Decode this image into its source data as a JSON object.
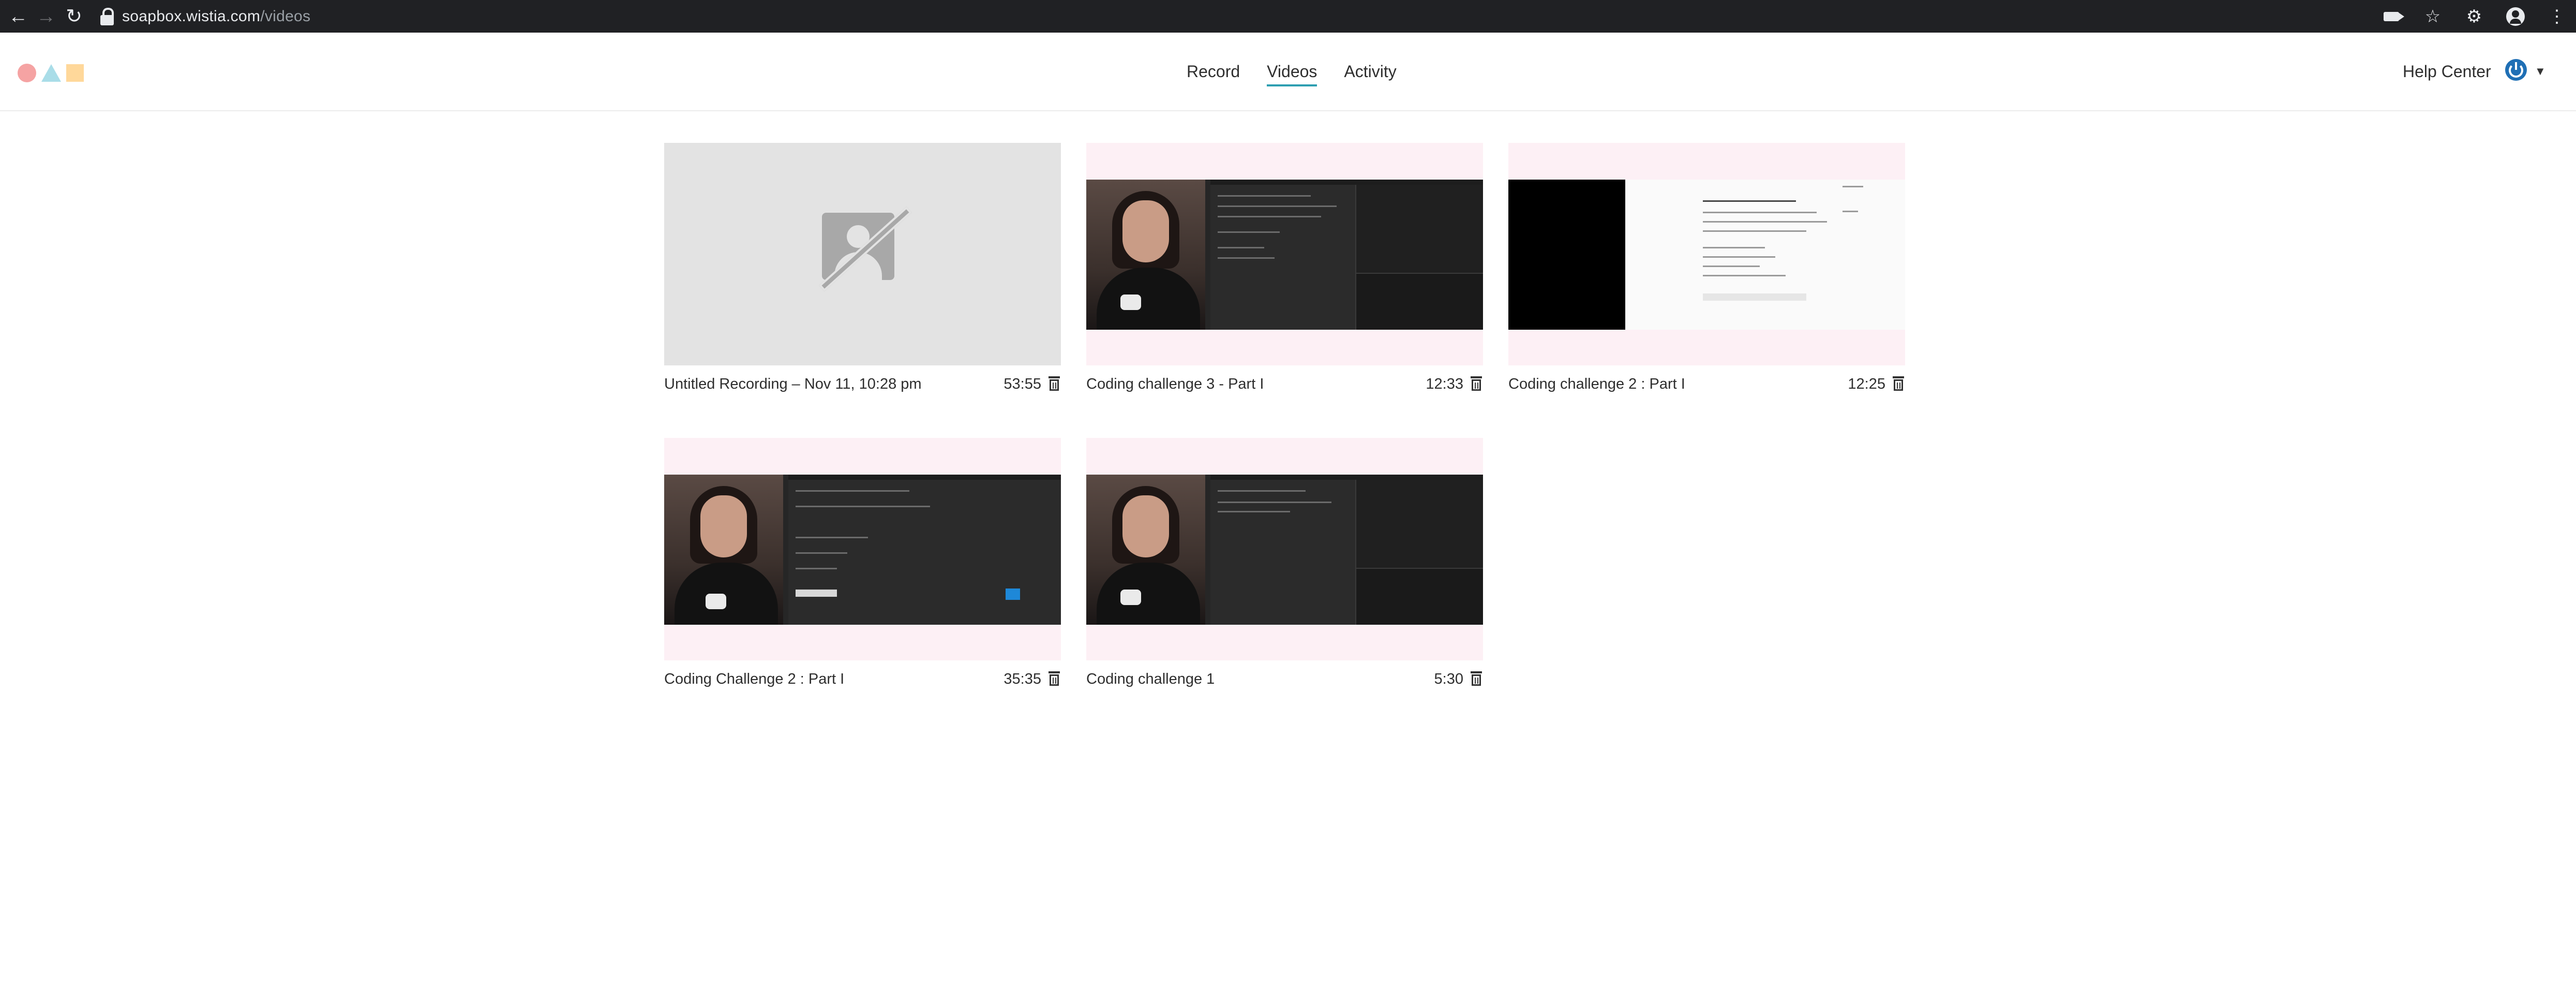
{
  "browser": {
    "url_host": "soapbox.wistia.com",
    "url_path": "/videos"
  },
  "nav": {
    "items": [
      {
        "label": "Record",
        "active": false
      },
      {
        "label": "Videos",
        "active": true
      },
      {
        "label": "Activity",
        "active": false
      }
    ],
    "help": "Help Center",
    "accent": "#2d9eb1"
  },
  "icons": {
    "back": "back-arrow-icon",
    "forward": "forward-arrow-icon",
    "reload": "reload-icon",
    "lock": "lock-icon",
    "camera": "camera-icon",
    "star": "star-icon",
    "extensions": "puzzle-icon",
    "account": "account-icon",
    "menu": "kebab-icon",
    "power": "power-icon",
    "delete": "trash-icon"
  },
  "videos": [
    {
      "title": "Untitled Recording – Nov 11, 10:28 pm",
      "duration": "53:55"
    },
    {
      "title": "Coding challenge 3 - Part I",
      "duration": "12:33"
    },
    {
      "title": "Coding challenge 2 : Part I",
      "duration": "12:25"
    },
    {
      "title": "Coding Challenge 2 : Part I",
      "duration": "35:35"
    },
    {
      "title": "Coding challenge 1",
      "duration": "5:30"
    }
  ]
}
